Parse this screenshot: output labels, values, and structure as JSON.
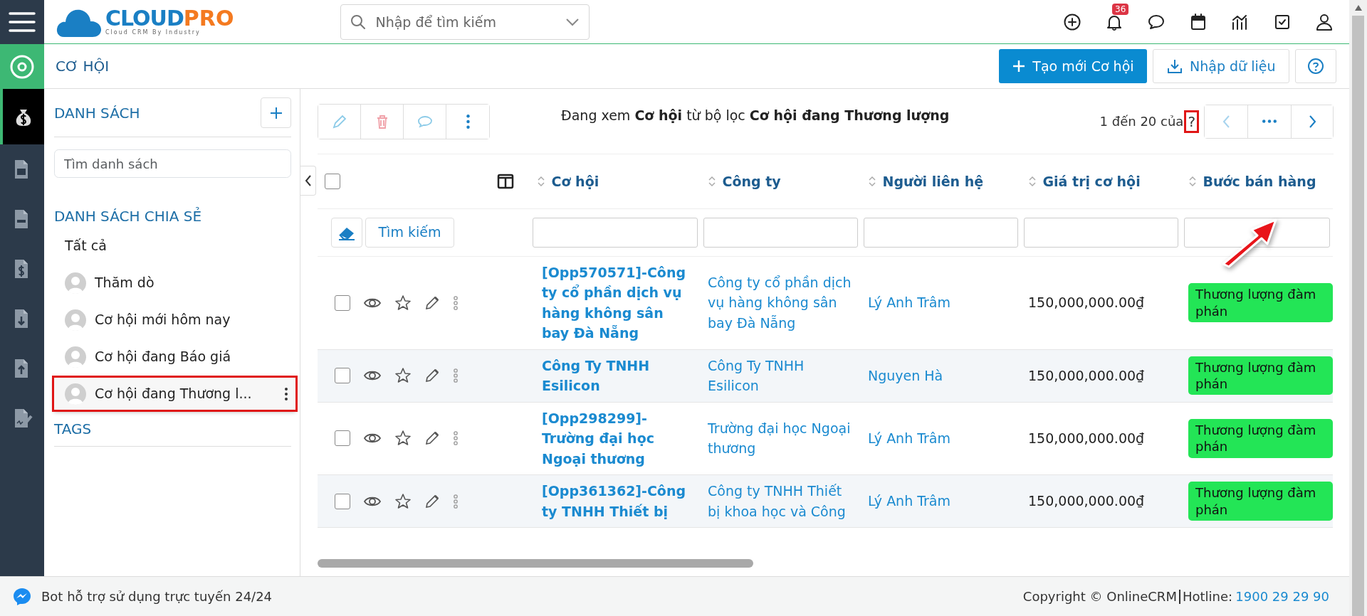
{
  "header": {
    "logo": {
      "part_1": "CLOUD",
      "part_2": "PRO",
      "tagline": "Cloud CRM By Industry"
    },
    "search": {
      "placeholder": "Nhập để tìm kiếm"
    },
    "notification_count": "36"
  },
  "rail": {
    "items": [
      {
        "selected": true
      },
      {
        "selected": false
      },
      {
        "selected": false
      },
      {
        "selected": false
      },
      {
        "selected": false
      },
      {
        "selected": false
      },
      {
        "selected": false
      }
    ]
  },
  "page": {
    "title": "CƠ HỘI",
    "buttons": [
      {
        "kind": "primary",
        "label": "Tạo mới Cơ hội"
      },
      {
        "kind": "import",
        "label": "Nhập dữ liệu"
      },
      {
        "kind": "help"
      }
    ]
  },
  "sidebar": {
    "title": "DANH SÁCH",
    "search": {
      "placeholder": "Tìm danh sách"
    },
    "shared_title": "DANH SÁCH CHIA SẺ",
    "items": [
      {
        "label": "Tất cả",
        "avatar": false,
        "highlighted": false
      },
      {
        "label": "Thăm dò",
        "avatar": true,
        "highlighted": false
      },
      {
        "label": "Cơ hội mới hôm nay",
        "avatar": true,
        "highlighted": false
      },
      {
        "label": "Cơ hội đang Báo giá",
        "avatar": true,
        "highlighted": false
      },
      {
        "label": "Cơ hội đang Thương l...",
        "avatar": true,
        "highlighted": true
      }
    ],
    "tags_title": "TAGS"
  },
  "toolbar": {
    "summary": "Đang xem **Cơ hội** từ bộ lọc **Cơ hội đang Thương lượng**",
    "pagination": {
      "range": "1 đến 20 của",
      "total": "?",
      "highlighted": true
    }
  },
  "table": {
    "select_all_checked": false,
    "columns": [
      "Cơ hội",
      "Công ty",
      "Người liên hệ",
      "Giá trị cơ hội",
      "Bước bán hàng"
    ],
    "search_button": "Tìm kiếm",
    "rows": [
      {
        "name": "[Opp570571]-Công ty cổ phần dịch vụ hàng không sân bay Đà Nẵng",
        "company": "Công ty cổ phần dịch vụ hàng không sân bay Đà Nẵng",
        "contact": "Lý Anh Trâm",
        "value": "150,000,000.00₫",
        "stage": "Thương lượng đàm phán",
        "checked": false
      },
      {
        "name": "Công Ty TNHH Esilicon",
        "company": "Công Ty TNHH Esilicon",
        "contact": "Nguyen Hà",
        "value": "150,000,000.00₫",
        "stage": "Thương lượng đàm phán",
        "checked": false
      },
      {
        "name": "[Opp298299]-Trường đại học Ngoại thương",
        "company": "Trường đại học Ngoại thương",
        "contact": "Lý Anh Trâm",
        "value": "150,000,000.00₫",
        "stage": "Thương lượng đàm phán",
        "checked": false
      },
      {
        "name": "[Opp361362]-Công ty TNHH Thiết bị",
        "company": "Công ty TNHH Thiết bị khoa học và Công",
        "contact": "Lý Anh Trâm",
        "value": "150,000,000.00₫",
        "stage": "Thương lượng đàm phán",
        "checked": false
      }
    ]
  },
  "footer": {
    "bot": "Bot hỗ trợ sử dụng trực tuyến 24/24",
    "copyright": "Copyright © OnlineCRM",
    "hotline_label": "Hotline:",
    "hotline": "1900 29 29 90"
  }
}
